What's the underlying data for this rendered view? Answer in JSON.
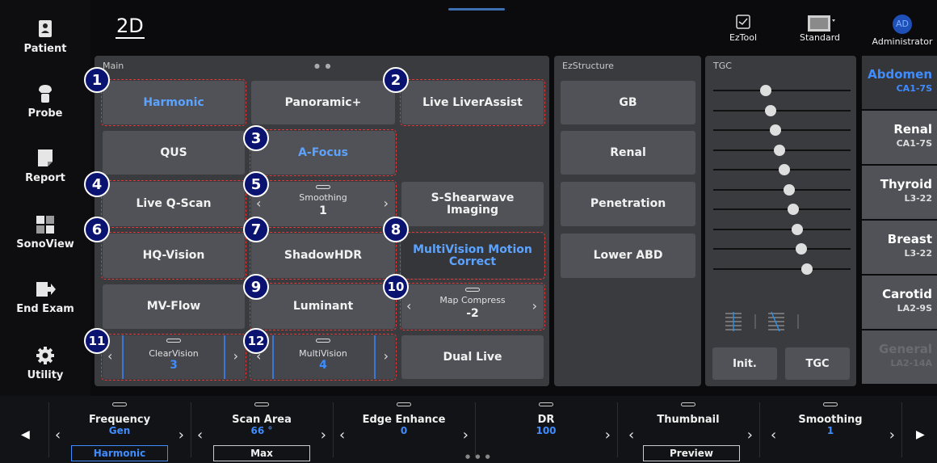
{
  "header": {
    "mode": "2D",
    "eztool_label": "EzTool",
    "standard_label": "Standard",
    "user_initials": "AD",
    "user_label": "Administrator"
  },
  "sidebar": {
    "items": [
      {
        "label": "Patient",
        "icon": "patient-icon"
      },
      {
        "label": "Probe",
        "icon": "probe-icon"
      },
      {
        "label": "Report",
        "icon": "report-icon"
      },
      {
        "label": "SonoView",
        "icon": "sonoview-icon"
      },
      {
        "label": "End Exam",
        "icon": "end-exam-icon"
      },
      {
        "label": "Utility",
        "icon": "gear-icon"
      }
    ]
  },
  "main_panel": {
    "title": "Main",
    "buttons": {
      "harmonic": "Harmonic",
      "panoramic": "Panoramic+",
      "live_liverassist": "Live LiverAssist",
      "qus": "QUS",
      "a_focus": "A-Focus",
      "live_qscan": "Live Q-Scan",
      "s_shearwave_l1": "S-Shearwave",
      "s_shearwave_l2": "Imaging",
      "hq_vision": "HQ-Vision",
      "shadowhdr": "ShadowHDR",
      "multivision_l1": "MultiVision Motion",
      "multivision_l2": "Correct",
      "mv_flow": "MV-Flow",
      "luminant": "Luminant",
      "dual_live": "Dual Live"
    },
    "steppers": {
      "smoothing": {
        "label": "Smoothing",
        "value": "1"
      },
      "map_compress": {
        "label": "Map Compress",
        "value": "-2"
      },
      "clearvision": {
        "label": "ClearVision",
        "value": "3"
      },
      "multivision": {
        "label": "MultiVision",
        "value": "4"
      }
    },
    "badges": [
      "1",
      "2",
      "3",
      "4",
      "5",
      "6",
      "7",
      "8",
      "9",
      "10",
      "11",
      "12"
    ]
  },
  "ezstructure": {
    "title": "EzStructure",
    "buttons": [
      "GB",
      "Renal",
      "Penetration",
      "Lower ABD"
    ]
  },
  "tgc": {
    "title": "TGC",
    "init_label": "Init.",
    "tgc_label": "TGC",
    "levels": [
      0.38,
      0.42,
      0.45,
      0.48,
      0.52,
      0.55,
      0.58,
      0.61,
      0.64,
      0.68
    ]
  },
  "presets": [
    {
      "name": "Abdomen",
      "probe": "CA1-7S",
      "state": "active"
    },
    {
      "name": "Renal",
      "probe": "CA1-7S",
      "state": "normal"
    },
    {
      "name": "Thyroid",
      "probe": "L3-22",
      "state": "normal"
    },
    {
      "name": "Breast",
      "probe": "L3-22",
      "state": "normal"
    },
    {
      "name": "Carotid",
      "probe": "LA2-9S",
      "state": "normal"
    },
    {
      "name": "General",
      "probe": "LA2-14A",
      "state": "disabled"
    }
  ],
  "bottom_bar": {
    "frequency": {
      "label": "Frequency",
      "value": "Gen",
      "sub": "Harmonic"
    },
    "scan_area": {
      "label": "Scan Area",
      "value": "66 °",
      "sub": "Max"
    },
    "edge_enhance": {
      "label": "Edge Enhance",
      "value": "0"
    },
    "dr": {
      "label": "DR",
      "value": "100"
    },
    "thumbnail": {
      "label": "Thumbnail",
      "sub": "Preview"
    },
    "smoothing": {
      "label": "Smoothing",
      "value": "1"
    }
  },
  "colors": {
    "accent_blue": "#3f8cff",
    "badge_navy": "#0a1470",
    "highlight_red": "#e03a3a",
    "panel_bg": "#3a3b3f",
    "button_bg": "#505257"
  }
}
